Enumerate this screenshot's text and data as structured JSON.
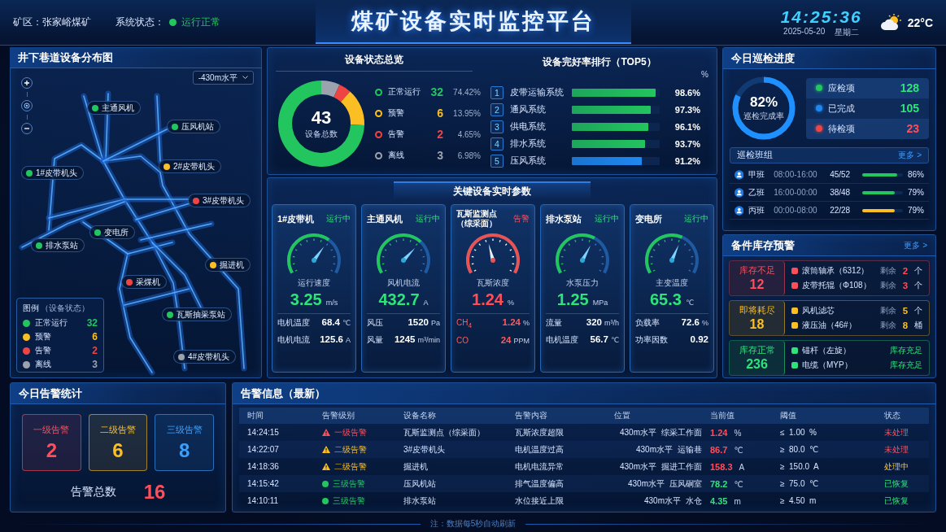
{
  "header": {
    "mine": "矿区：张家峪煤矿",
    "status_label": "系统状态：",
    "status": {
      "text": "运行正常",
      "kind": "normal"
    },
    "title": "煤矿设备实时监控平台",
    "time": "14:25:36",
    "date": "2025-05-20",
    "weekday": "星期二",
    "temperature": "22°C"
  },
  "map": {
    "title": "井下巷道设备分布图",
    "level_select": "-430m水平",
    "markers": [
      {
        "name": "主通风机",
        "color": "#22c55e"
      },
      {
        "name": "压风机站",
        "color": "#22c55e"
      },
      {
        "name": "2#皮带机头",
        "color": "#fbbf24"
      },
      {
        "name": "1#皮带机头",
        "color": "#22c55e"
      },
      {
        "name": "3#皮带机头",
        "color": "#ef4444"
      },
      {
        "name": "变电所",
        "color": "#22c55e"
      },
      {
        "name": "排水泵站",
        "color": "#22c55e"
      },
      {
        "name": "掘进机",
        "color": "#fbbf24"
      },
      {
        "name": "采煤机",
        "color": "#ef4444"
      },
      {
        "name": "瓦斯抽采泵站",
        "color": "#22c55e"
      },
      {
        "name": "4#皮带机头",
        "color": "#9ca3af"
      }
    ],
    "legend": {
      "title": "图例",
      "subtitle": "（设备状态）",
      "items": [
        {
          "label": "正常运行",
          "count": "32",
          "color": "#22c55e"
        },
        {
          "label": "预警",
          "count": "6",
          "color": "#fbbf24"
        },
        {
          "label": "告警",
          "count": "2",
          "color": "#ef4444"
        },
        {
          "label": "离线",
          "count": "3",
          "color": "#9ca3af"
        }
      ]
    }
  },
  "overview": {
    "title": "设备状态总览",
    "total": "43",
    "total_label": "设备总数",
    "statuses": [
      {
        "count": "32",
        "percent": "74.42%",
        "color": "#22c55e"
      },
      {
        "count": "6",
        "percent": "13.95%",
        "color": "#fbbf24"
      },
      {
        "count": "2",
        "percent": "4.65%",
        "color": "#ef4444"
      },
      {
        "count": "3",
        "percent": "6.98%",
        "color": "#9ca3af"
      }
    ],
    "chart_data": {
      "type": "donut",
      "categories": [
        "正常运行",
        "预警",
        "告警",
        "离线"
      ],
      "values": [
        74.42,
        13.95,
        4.65,
        6.98
      ]
    }
  },
  "ranking": {
    "title": "设备完好率排行（TOP5）",
    "unit_header": "%",
    "items": [
      {
        "rank": "1",
        "name": "皮带运输系统",
        "value": "98.6%",
        "color": "#22c55e"
      },
      {
        "rank": "2",
        "name": "通风系统",
        "value": "97.3%",
        "color": "#22c55e"
      },
      {
        "rank": "3",
        "name": "供电系统",
        "value": "96.1%",
        "color": "#22c55e"
      },
      {
        "rank": "4",
        "name": "排水系统",
        "value": "93.7%",
        "color": "#22c55e"
      },
      {
        "rank": "5",
        "name": "压风系统",
        "value": "91.2%",
        "color": "#1e88f0"
      }
    ]
  },
  "key_params": {
    "title": "关键设备实时参数",
    "devices": [
      {
        "name": "1#皮带机",
        "status": "运行中",
        "kind": "running",
        "metric": "运行速度",
        "value": "3.25",
        "unit": "m/s",
        "params": [
          {
            "label": "电机温度",
            "value": "68.4",
            "unit": "℃"
          },
          {
            "label": "电机电流",
            "value": "125.6",
            "unit": "A"
          }
        ]
      },
      {
        "name": "主通风机",
        "status": "运行中",
        "kind": "running",
        "metric": "风机电流",
        "value": "432.7",
        "unit": "A",
        "params": [
          {
            "label": "风压",
            "value": "1520",
            "unit": "Pa"
          },
          {
            "label": "风量",
            "value": "1245",
            "unit": "m³/min"
          }
        ]
      },
      {
        "name": "瓦斯监测点（综采面）",
        "status": "告警",
        "kind": "alarm",
        "metric": "瓦斯浓度",
        "value": "1.24",
        "unit": "%",
        "params": [
          {
            "label": "CH$_{4}$",
            "value": "1.24",
            "unit": "%"
          },
          {
            "label": "CO",
            "value": "24",
            "unit": "PPM"
          }
        ]
      },
      {
        "name": "排水泵站",
        "status": "运行中",
        "kind": "running",
        "metric": "水泵压力",
        "value": "1.25",
        "unit": "MPa",
        "params": [
          {
            "label": "流量",
            "value": "320",
            "unit": "m³/h"
          },
          {
            "label": "电机温度",
            "value": "56.7",
            "unit": "℃"
          }
        ]
      },
      {
        "name": "变电所",
        "status": "运行中",
        "kind": "running",
        "metric": "主变温度",
        "value": "65.3",
        "unit": "℃",
        "params": [
          {
            "label": "负载率",
            "value": "72.6",
            "unit": "%"
          },
          {
            "label": "功率因数",
            "value": "0.92"
          }
        ]
      }
    ]
  },
  "patrol": {
    "title": "今日巡检进度",
    "rate": "82%",
    "rate_label": "巡检完成率",
    "stats": [
      {
        "label": "应检项",
        "value": "128",
        "kind": "total",
        "color": "#22c55e"
      },
      {
        "label": "已完成",
        "value": "105",
        "kind": "done",
        "color": "#1e88f0"
      },
      {
        "label": "待检项",
        "value": "23",
        "kind": "pending",
        "color": "#ef4444"
      }
    ],
    "groups_title": "巡检班组",
    "more": "更多 >",
    "shifts": [
      {
        "name": "甲班",
        "time": "08:00-16:00",
        "ratio": "45/52",
        "level": 0.86,
        "percent": "86%",
        "color": "#22c55e"
      },
      {
        "name": "乙班",
        "time": "16:00-00:00",
        "ratio": "38/48",
        "level": 0.79,
        "percent": "79%",
        "color": "#22c55e"
      },
      {
        "name": "丙班",
        "time": "00:00-08:00",
        "ratio": "22/28",
        "level": 0.79,
        "percent": "79%",
        "color": "#fbbf24"
      }
    ]
  },
  "stock": {
    "title": "备件库存预警",
    "more": "更多 >",
    "groups": [
      {
        "kind": "shortage",
        "title": "库存不足",
        "count": "12",
        "items": [
          {
            "kind": "count",
            "name": "滚筒轴承（6312）",
            "remain_label": "剩余",
            "qty": "2",
            "unit": "个"
          },
          {
            "kind": "count",
            "name": "皮带托辊（Φ108）",
            "remain_label": "剩余",
            "qty": "3",
            "unit": "个"
          }
        ]
      },
      {
        "kind": "low",
        "title": "即将耗尽",
        "count": "18",
        "items": [
          {
            "kind": "count",
            "name": "风机滤芯",
            "remain_label": "剩余",
            "qty": "5",
            "unit": "个"
          },
          {
            "kind": "count",
            "name": "液压油（46#）",
            "remain_label": "剩余",
            "qty": "8",
            "unit": "桶"
          }
        ]
      },
      {
        "kind": "normal",
        "title": "库存正常",
        "count": "236",
        "items": [
          {
            "kind": "status",
            "name": "锚杆（左旋）",
            "status": "库存充足"
          },
          {
            "kind": "status",
            "name": "电缆（MYP）",
            "status": "库存充足"
          }
        ]
      }
    ]
  },
  "alarm_stats": {
    "title": "今日告警统计",
    "levels": [
      {
        "label": "一级告警",
        "count": "2",
        "kind": "level1"
      },
      {
        "label": "二级告警",
        "count": "6",
        "kind": "level2"
      },
      {
        "label": "三级告警",
        "count": "8",
        "kind": "level3"
      }
    ],
    "total_label": "告警总数",
    "total": "16"
  },
  "alarm_table": {
    "title": "告警信息（最新）",
    "columns": [
      "时间",
      "告警级别",
      "设备名称",
      "告警内容",
      "位置",
      "当前值",
      "阈值",
      "状态"
    ],
    "rows": [
      {
        "time": "14:24:15",
        "level": {
          "label": "一级告警",
          "kind": "level1"
        },
        "device": "瓦斯监测点（综采面）",
        "content": "瓦斯浓度超限",
        "location_level": "430m水平",
        "location_area": "综采工作面",
        "value": "1.24",
        "unit": "%",
        "value_alarm": true,
        "threshold": "≤  1.00  %",
        "status": {
          "label": "未处理",
          "kind": "pending"
        }
      },
      {
        "time": "14:22:07",
        "level": {
          "label": "二级告警",
          "kind": "level2"
        },
        "device": "3#皮带机头",
        "content": "电机温度过高",
        "location_level": "430m水平",
        "location_area": "运输巷",
        "value": "86.7",
        "unit": "℃",
        "value_alarm": true,
        "threshold": "≥  80.0  ℃",
        "status": {
          "label": "未处理",
          "kind": "pending"
        }
      },
      {
        "time": "14:18:36",
        "level": {
          "label": "二级告警",
          "kind": "level2"
        },
        "device": "掘进机",
        "content": "电机电流异常",
        "location_level": "430m水平",
        "location_area": "掘进工作面",
        "value": "158.3",
        "unit": "A",
        "value_alarm": true,
        "threshold": "≥  150.0  A",
        "status": {
          "label": "处理中",
          "kind": "processing"
        }
      },
      {
        "time": "14:15:42",
        "level": {
          "label": "三级告警",
          "kind": "level3"
        },
        "device": "压风机站",
        "content": "排气温度偏高",
        "location_level": "430m水平",
        "location_area": "压风硐室",
        "value": "78.2",
        "unit": "℃",
        "value_alarm": false,
        "threshold": "≥  75.0  ℃",
        "status": {
          "label": "已恢复",
          "kind": "resolved"
        }
      },
      {
        "time": "14:10:11",
        "level": {
          "label": "三级告警",
          "kind": "level3"
        },
        "device": "排水泵站",
        "content": "水位接近上限",
        "location_level": "430m水平",
        "location_area": "水仓",
        "value": "4.35",
        "unit": "m",
        "value_alarm": false,
        "threshold": "≥  4.50  m",
        "status": {
          "label": "已恢复",
          "kind": "resolved"
        }
      }
    ]
  },
  "footer": {
    "note": "注：数据每5秒自动刷新"
  }
}
